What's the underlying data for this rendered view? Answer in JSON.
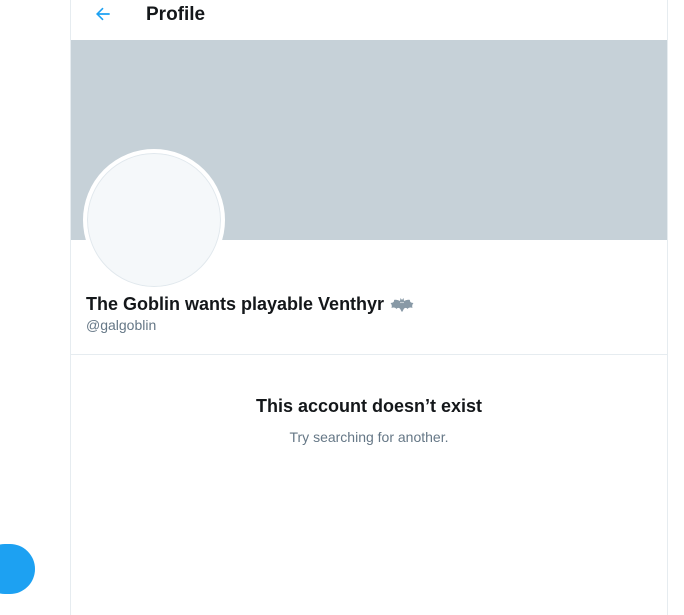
{
  "header": {
    "title": "Profile",
    "back_icon": "arrow-left-icon"
  },
  "profile": {
    "display_name": "The Goblin wants playable Venthyr",
    "name_emoji_icon": "bat-icon",
    "handle": "@galgoblin"
  },
  "empty_state": {
    "title": "This account doesn’t exist",
    "subtitle": "Try searching for another."
  },
  "colors": {
    "accent": "#1da1f2",
    "banner": "#c6d1d8",
    "avatar_bg": "#f5f8fa",
    "text_primary": "#14171a",
    "text_secondary": "#657786"
  }
}
